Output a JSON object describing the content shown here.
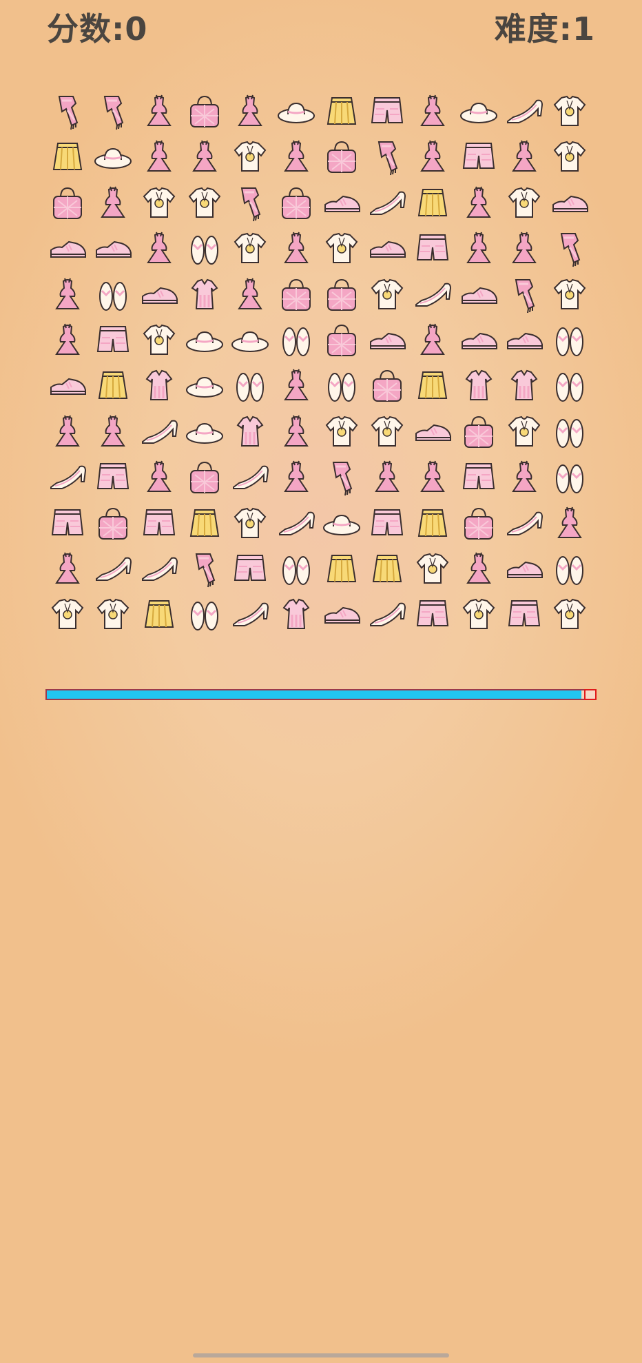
{
  "hud": {
    "score_label": "分数:0",
    "level_label": "难度:1"
  },
  "grid": {
    "rows": 12,
    "cols": 12,
    "cells": [
      [
        "scarf",
        "scarf",
        "dress",
        "handbag",
        "dress",
        "hat",
        "skirt",
        "shorts",
        "dress",
        "hat",
        "heel",
        "tshirt"
      ],
      [
        "skirt",
        "hat",
        "dress",
        "dress",
        "tshirt",
        "dress",
        "handbag",
        "scarf",
        "dress",
        "shorts",
        "dress",
        "tshirt"
      ],
      [
        "handbag",
        "dress",
        "tshirt",
        "tshirt",
        "scarf",
        "handbag",
        "sneaker",
        "heel",
        "skirt",
        "dress",
        "tshirt",
        "sneaker"
      ],
      [
        "sneaker",
        "sneaker",
        "dress",
        "flipflops",
        "tshirt",
        "dress",
        "tshirt",
        "sneaker",
        "shorts",
        "dress",
        "dress",
        "scarf"
      ],
      [
        "dress",
        "flipflops",
        "sneaker",
        "babydress",
        "dress",
        "handbag",
        "handbag",
        "tshirt",
        "heel",
        "sneaker",
        "scarf",
        "tshirt"
      ],
      [
        "dress",
        "shorts",
        "tshirt",
        "hat",
        "hat",
        "flipflops",
        "handbag",
        "sneaker",
        "dress",
        "sneaker",
        "sneaker",
        "flipflops"
      ],
      [
        "sneaker",
        "skirt",
        "babydress",
        "hat",
        "flipflops",
        "dress",
        "flipflops",
        "handbag",
        "skirt",
        "babydress",
        "babydress",
        "flipflops"
      ],
      [
        "dress",
        "dress",
        "heel",
        "hat",
        "babydress",
        "dress",
        "tshirt",
        "tshirt",
        "sneaker",
        "handbag",
        "tshirt",
        "flipflops"
      ],
      [
        "heel",
        "shorts",
        "dress",
        "handbag",
        "heel",
        "dress",
        "scarf",
        "dress",
        "dress",
        "shorts",
        "dress",
        "flipflops"
      ],
      [
        "shorts",
        "handbag",
        "shorts",
        "skirt",
        "tshirt",
        "heel",
        "hat",
        "shorts",
        "skirt",
        "handbag",
        "heel",
        "dress"
      ],
      [
        "dress",
        "heel",
        "heel",
        "scarf",
        "shorts",
        "flipflops",
        "skirt",
        "skirt",
        "tshirt",
        "dress",
        "sneaker",
        "flipflops"
      ],
      [
        "tshirt",
        "tshirt",
        "skirt",
        "flipflops",
        "heel",
        "babydress",
        "sneaker",
        "heel",
        "shorts",
        "tshirt",
        "shorts",
        "tshirt"
      ]
    ]
  },
  "timer": {
    "remaining_fraction": 0.975,
    "fill_color": "#21c6f0",
    "border_color": "#9b3a4c",
    "cap_color": "#e01b1b"
  },
  "colors": {
    "pink": "#f4a6c4",
    "pink_light": "#f9c9d9",
    "yellow": "#f8d977",
    "cream": "#fff6ea",
    "outline": "#3a2e2e",
    "text": "#4a4540"
  }
}
